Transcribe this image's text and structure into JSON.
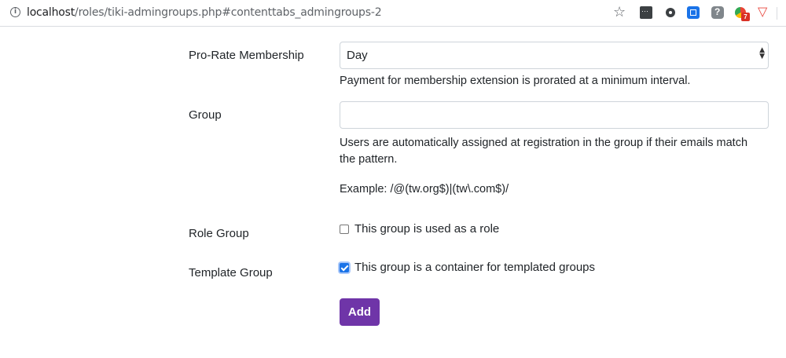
{
  "browser": {
    "url_host": "localhost",
    "url_path": "/roles/tiki-admingroups.php#contenttabs_admingroups-2",
    "badge_count": "7"
  },
  "form": {
    "prorate": {
      "label": "Pro-Rate Membership",
      "value": "Day",
      "help": "Payment for membership extension is prorated at a minimum interval."
    },
    "group": {
      "label": "Group",
      "value": "",
      "help_line1": "Users are automatically assigned at registration in the group if their emails match",
      "help_line2": "the pattern.",
      "example": "Example: /@(tw.org$)|(tw\\.com$)/"
    },
    "role_group": {
      "label": "Role Group",
      "checkbox_label": "This group is used as a role",
      "checked": false
    },
    "template_group": {
      "label": "Template Group",
      "checkbox_label": "This group is a container for templated groups",
      "checked": true
    },
    "add_button": "Add"
  }
}
